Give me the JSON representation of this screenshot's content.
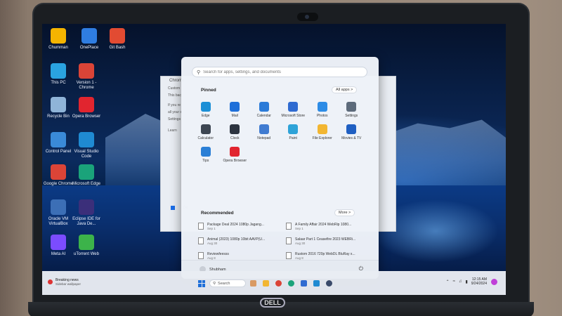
{
  "desktop": {
    "icons": [
      {
        "label": "Chumman",
        "icon": "folder-icon",
        "color": "#f4b400"
      },
      {
        "label": "OnePlace",
        "icon": "app-icon",
        "color": "#2f7de1"
      },
      {
        "label": "Git Bash",
        "icon": "git-bash-icon",
        "color": "#e24b32"
      },
      {
        "label": "This PC",
        "icon": "computer-icon",
        "color": "#2aa3e0"
      },
      {
        "label": "Version 1 - Chrome",
        "icon": "chrome-icon",
        "color": "#db4437"
      },
      {
        "label": "Recycle Bin",
        "icon": "recycle-bin-icon",
        "color": "#8fb4d8"
      },
      {
        "label": "Opera Browser",
        "icon": "opera-icon",
        "color": "#e1252f"
      },
      {
        "label": "Control Panel",
        "icon": "control-panel-icon",
        "color": "#3a8ad8"
      },
      {
        "label": "Visual Studio Code",
        "icon": "vscode-icon",
        "color": "#1f8ad2"
      },
      {
        "label": "Google Chrome",
        "icon": "chrome-icon",
        "color": "#db4437"
      },
      {
        "label": "Microsoft Edge",
        "icon": "edge-icon",
        "color": "#1aa37a"
      },
      {
        "label": "Oracle VM VirtualBox",
        "icon": "virtualbox-icon",
        "color": "#3c6fb6"
      },
      {
        "label": "Eclipse IDE for Java De...",
        "icon": "eclipse-icon",
        "color": "#3b2f7a"
      },
      {
        "label": "Meta AI",
        "icon": "meta-ai-icon",
        "color": "#7b4cff"
      },
      {
        "label": "uTorrent Web",
        "icon": "utorrent-icon",
        "color": "#3cb34a"
      }
    ]
  },
  "background_dialog": {
    "title": "Chrome",
    "lines": [
      "Custom",
      "This bac",
      "If you re",
      "all your s",
      "Settings",
      "Learn"
    ],
    "checkbox": "Do"
  },
  "start_menu": {
    "search_placeholder": "Search for apps, settings, and documents",
    "pinned_title": "Pinned",
    "all_apps_label": "All apps >",
    "pinned_apps": [
      {
        "label": "Edge",
        "icon": "edge-icon",
        "color": "#1b8fd6"
      },
      {
        "label": "Mail",
        "icon": "mail-icon",
        "color": "#1e6fd9"
      },
      {
        "label": "Calendar",
        "icon": "calendar-icon",
        "color": "#2b7bd8"
      },
      {
        "label": "Microsoft Store",
        "icon": "store-icon",
        "color": "#2f6bd1"
      },
      {
        "label": "Photos",
        "icon": "photos-icon",
        "color": "#2d8ce6"
      },
      {
        "label": "Settings",
        "icon": "settings-icon",
        "color": "#5d6b7b"
      },
      {
        "label": "Calculator",
        "icon": "calculator-icon",
        "color": "#3d4652"
      },
      {
        "label": "Clock",
        "icon": "clock-icon",
        "color": "#2c3440"
      },
      {
        "label": "Notepad",
        "icon": "notepad-icon",
        "color": "#3f7bd1"
      },
      {
        "label": "Paint",
        "icon": "paint-icon",
        "color": "#2ea3d8"
      },
      {
        "label": "File Explorer",
        "icon": "file-explorer-icon",
        "color": "#f2b632"
      },
      {
        "label": "Movies & TV",
        "icon": "movies-tv-icon",
        "color": "#1f5fc2"
      },
      {
        "label": "Tips",
        "icon": "tips-icon",
        "color": "#2a7fd6"
      },
      {
        "label": "Opera Browser",
        "icon": "opera-icon",
        "color": "#e1252f"
      }
    ],
    "recommended_title": "Recommended",
    "more_label": "More >",
    "recommended": [
      {
        "name": "Package Deal 2024 1080p Jagang...",
        "date": "Sep 1"
      },
      {
        "name": "A Family Affair 2024 WebRip 1080...",
        "date": "Sep 1"
      },
      {
        "name": "Animal (2023) 1080p 10bit AAVP(U...",
        "date": "Aug 30"
      },
      {
        "name": "Salaar Part 1 Ceasefire 2023 WEBRi...",
        "date": "Aug 30"
      },
      {
        "name": "Reviewfeesss",
        "date": "Aug 8"
      },
      {
        "name": "Rustom 2016 720p WebDL BluRay x...",
        "date": "Aug 8"
      }
    ],
    "user_name": "Shubham"
  },
  "taskbar": {
    "news_title": "Breaking news",
    "news_sub": "Sidebar wallpaper",
    "search_label": "Search",
    "time": "12:15 AM",
    "date": "9/24/2024"
  }
}
